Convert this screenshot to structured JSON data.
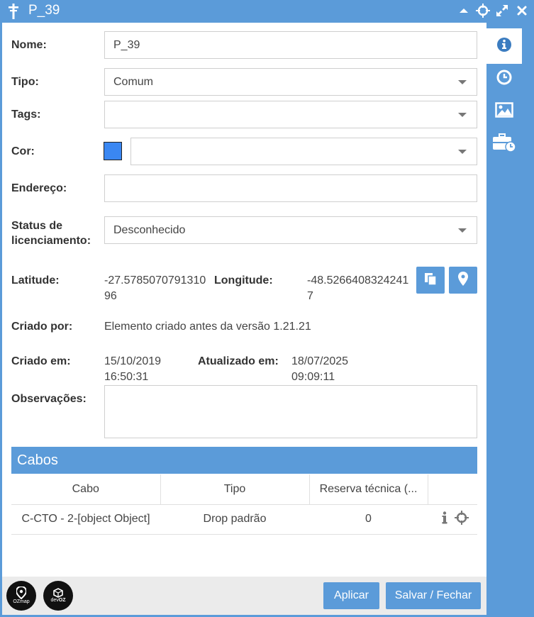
{
  "window": {
    "title": "P_39",
    "icons": [
      "pole-icon",
      "collapse-icon",
      "move-icon",
      "maximize-icon",
      "close-icon"
    ]
  },
  "sidebar_tabs": [
    "info-icon",
    "history-icon",
    "image-icon",
    "toolbox-clock-icon"
  ],
  "form": {
    "nome": {
      "label": "Nome:",
      "value": "P_39"
    },
    "tipo": {
      "label": "Tipo:",
      "value": "Comum"
    },
    "tags": {
      "label": "Tags:",
      "value": ""
    },
    "cor": {
      "label": "Cor:",
      "swatch": "#3a87f2",
      "value": ""
    },
    "endereco": {
      "label": "Endereço:",
      "value": ""
    },
    "status": {
      "label_line1": "Status de",
      "label_line2": "licenciamento:",
      "value": "Desconhecido"
    },
    "latitude": {
      "label": "Latitude:",
      "value": "-27.578507079131096"
    },
    "longitude": {
      "label": "Longitude:",
      "value": "-48.52664083242417"
    },
    "criado_por": {
      "label": "Criado por:",
      "value": "Elemento criado antes da versão 1.21.21"
    },
    "criado_em": {
      "label": "Criado em:",
      "date": "15/10/2019",
      "time": "16:50:31"
    },
    "atualizado_em": {
      "label": "Atualizado em:",
      "date": "18/07/2025",
      "time": "09:09:11"
    },
    "observacoes": {
      "label": "Observações:",
      "value": ""
    }
  },
  "cabos": {
    "title": "Cabos",
    "columns": [
      "Cabo",
      "Tipo",
      "Reserva técnica (..."
    ],
    "rows": [
      {
        "cabo": "C-CTO - 2-[object Object]",
        "tipo": "Drop padrão",
        "reserva": "0"
      }
    ]
  },
  "footer": {
    "logo1_text": "OZmap",
    "logo2_line1": "dev",
    "logo2_line2": "OZ",
    "apply_label": "Aplicar",
    "save_close_label": "Salvar / Fechar"
  },
  "colors": {
    "accent": "#5b9bd9",
    "swatch": "#3a87f2"
  }
}
